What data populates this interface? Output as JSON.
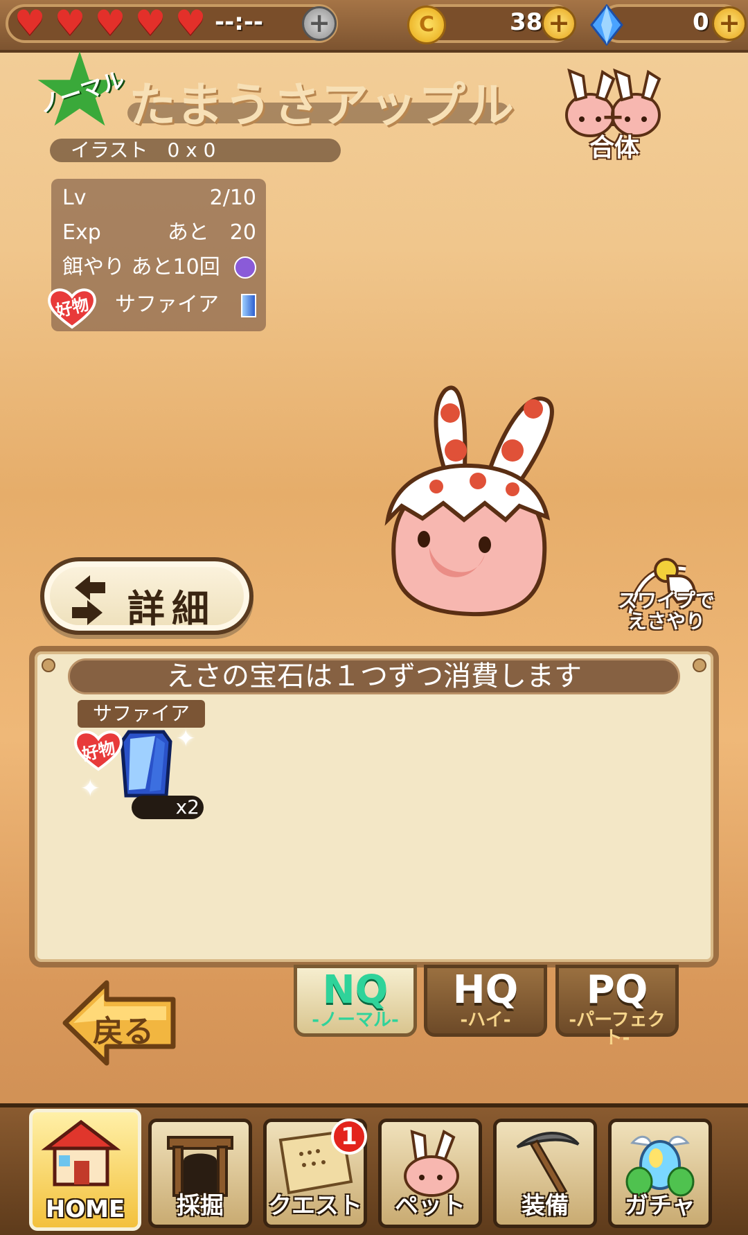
{
  "top_bar": {
    "hearts": 5,
    "stamina_timer": "--:--",
    "coins": "38",
    "gems": "0"
  },
  "pet": {
    "rank": "ノーマル",
    "name": "たまうさアップル",
    "illust": "イラスト　0 x 0",
    "fusion_label": "合体",
    "stats": {
      "lv_label": "Lv",
      "lv_value": "2/10",
      "exp_label": "Exp",
      "exp_value": "あと　20",
      "feed_label": "餌やり あと10回",
      "fav_badge": "好物",
      "fav_item": "サファイア"
    }
  },
  "swipe_hint": {
    "line1": "スワイプで",
    "line2": "えさやり"
  },
  "detail_button": "詳細",
  "feed_panel": {
    "header": "えさの宝石は１つずつ消費します",
    "items": [
      {
        "label": "サファイア",
        "fav_badge": "好物",
        "count": "x2"
      }
    ]
  },
  "quality_tabs": [
    {
      "big": "NQ",
      "small": "-ノーマル-",
      "selected": true
    },
    {
      "big": "HQ",
      "small": "-ハイ-",
      "selected": false
    },
    {
      "big": "PQ",
      "small": "-パーフェクト-",
      "selected": false
    }
  ],
  "back_button": "戻る",
  "nav": [
    {
      "label": "HOME",
      "icon": "house-icon",
      "active": true
    },
    {
      "label": "採掘",
      "icon": "mine-icon"
    },
    {
      "label": "クエスト",
      "icon": "scroll-icon",
      "badge": "1"
    },
    {
      "label": "ペット",
      "icon": "pet-icon"
    },
    {
      "label": "装備",
      "icon": "pickaxe-icon"
    },
    {
      "label": "ガチャ",
      "icon": "egg-icon"
    }
  ],
  "colors": {
    "accent_green": "#2fd39a",
    "heart_red": "#e3302a",
    "wood_brown": "#7a4e2a"
  }
}
